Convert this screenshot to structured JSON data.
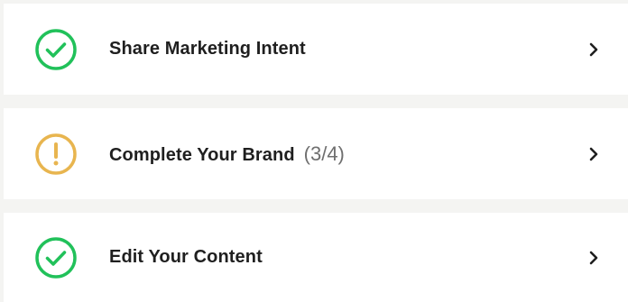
{
  "colors": {
    "background": "#f4f4f2",
    "card": "#ffffff",
    "success": "#21c15a",
    "warning": "#e8b54f",
    "text": "#1f1f1f",
    "muted": "#6f6f6f"
  },
  "steps": [
    {
      "label": "Share Marketing Intent",
      "status": "complete",
      "icon": "check-circle-icon",
      "progress": ""
    },
    {
      "label": "Complete Your Brand",
      "status": "incomplete",
      "icon": "exclamation-circle-icon",
      "progress": "(3/4)"
    },
    {
      "label": "Edit Your Content",
      "status": "complete",
      "icon": "check-circle-icon",
      "progress": ""
    }
  ]
}
